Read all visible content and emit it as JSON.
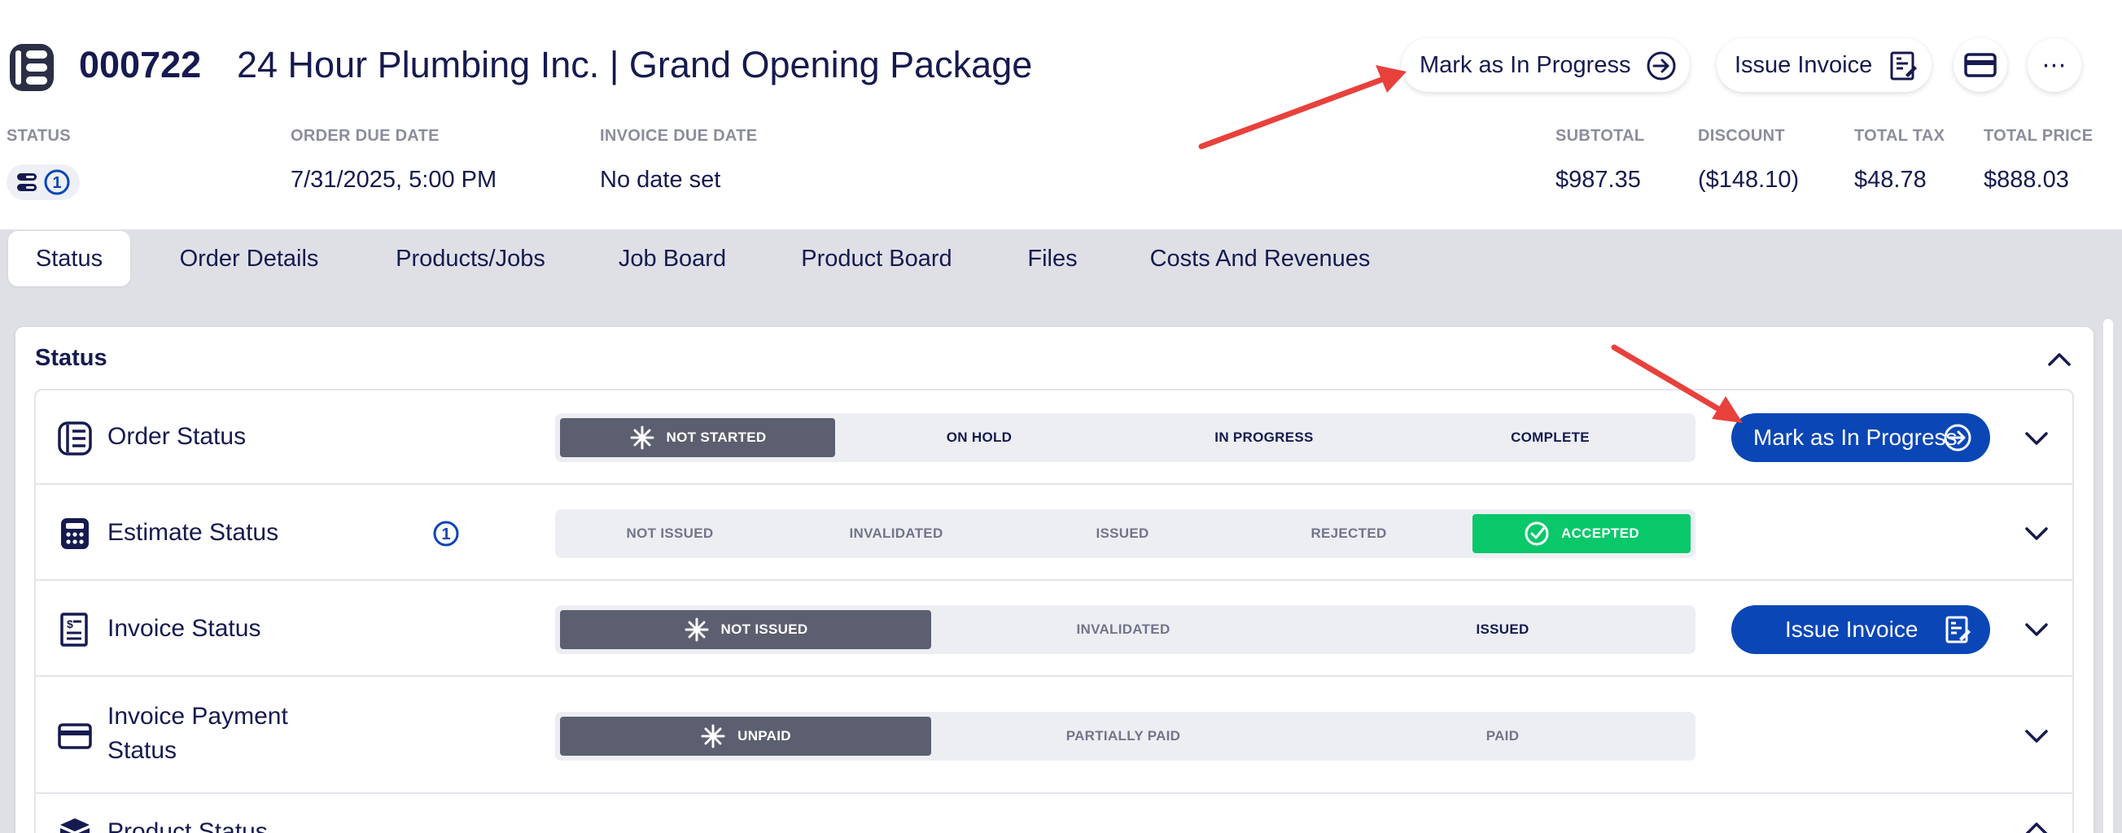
{
  "header": {
    "order_number": "000722",
    "title": "24 Hour Plumbing Inc. | Grand Opening Package",
    "mark_progress_label": "Mark as In Progress",
    "issue_invoice_label": "Issue Invoice",
    "more_label": "⋯",
    "status_badge_count": "1"
  },
  "meta": {
    "status_label": "STATUS",
    "order_due_label": "ORDER DUE DATE",
    "order_due_value": "7/31/2025, 5:00 PM",
    "invoice_due_label": "INVOICE DUE DATE",
    "invoice_due_value": "No date set",
    "subtotal_label": "SUBTOTAL",
    "subtotal_value": "$987.35",
    "discount_label": "DISCOUNT",
    "discount_value": "($148.10)",
    "tax_label": "TOTAL TAX",
    "tax_value": "$48.78",
    "total_label": "TOTAL PRICE",
    "total_value": "$888.03"
  },
  "tabs": [
    {
      "label": "Status"
    },
    {
      "label": "Order Details"
    },
    {
      "label": "Products/Jobs"
    },
    {
      "label": "Job Board"
    },
    {
      "label": "Product Board"
    },
    {
      "label": "Files"
    },
    {
      "label": "Costs And Revenues"
    }
  ],
  "panel": {
    "title": "Status"
  },
  "rows": {
    "order": {
      "label": "Order Status",
      "steps": [
        "NOT STARTED",
        "ON HOLD",
        "IN PROGRESS",
        "COMPLETE"
      ],
      "action_label": "Mark as In Progress"
    },
    "estimate": {
      "label": "Estimate Status",
      "badge": "1",
      "steps": [
        "NOT ISSUED",
        "INVALIDATED",
        "ISSUED",
        "REJECTED",
        "ACCEPTED"
      ]
    },
    "invoice": {
      "label": "Invoice Status",
      "steps": [
        "NOT ISSUED",
        "INVALIDATED",
        "ISSUED"
      ],
      "action_label": "Issue Invoice"
    },
    "payment": {
      "label_line1": "Invoice Payment",
      "label_line2": "Status",
      "steps": [
        "UNPAID",
        "PARTIALLY PAID",
        "PAID"
      ]
    },
    "product": {
      "label": "Product Status"
    }
  },
  "colors": {
    "navy": "#161a4f",
    "primary_blue": "#0a46b5",
    "active_step": "#5c5f6f",
    "accepted_green": "#08c86a",
    "annotation_arrow": "#e8413c"
  }
}
